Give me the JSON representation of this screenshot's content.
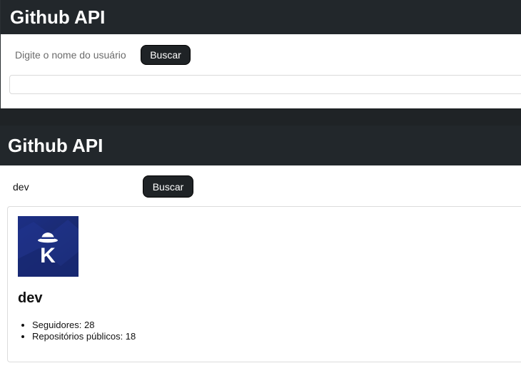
{
  "top_panel": {
    "title": "Github API",
    "search": {
      "placeholder": "Digite o nome do usuário",
      "value": ""
    },
    "button_label": "Buscar"
  },
  "bottom_panel": {
    "title": "Github API",
    "search": {
      "placeholder": "Digite o nome do usuário",
      "value": "dev"
    },
    "button_label": "Buscar",
    "profile": {
      "avatar_letter": "K",
      "name": "dev",
      "stats": [
        {
          "label": "Seguidores: 28"
        },
        {
          "label": "Repositórios públicos: 18"
        }
      ]
    }
  },
  "colors": {
    "header_bg": "#22272b",
    "button_bg": "#1f2326",
    "avatar_bg": "#1c2f86"
  }
}
